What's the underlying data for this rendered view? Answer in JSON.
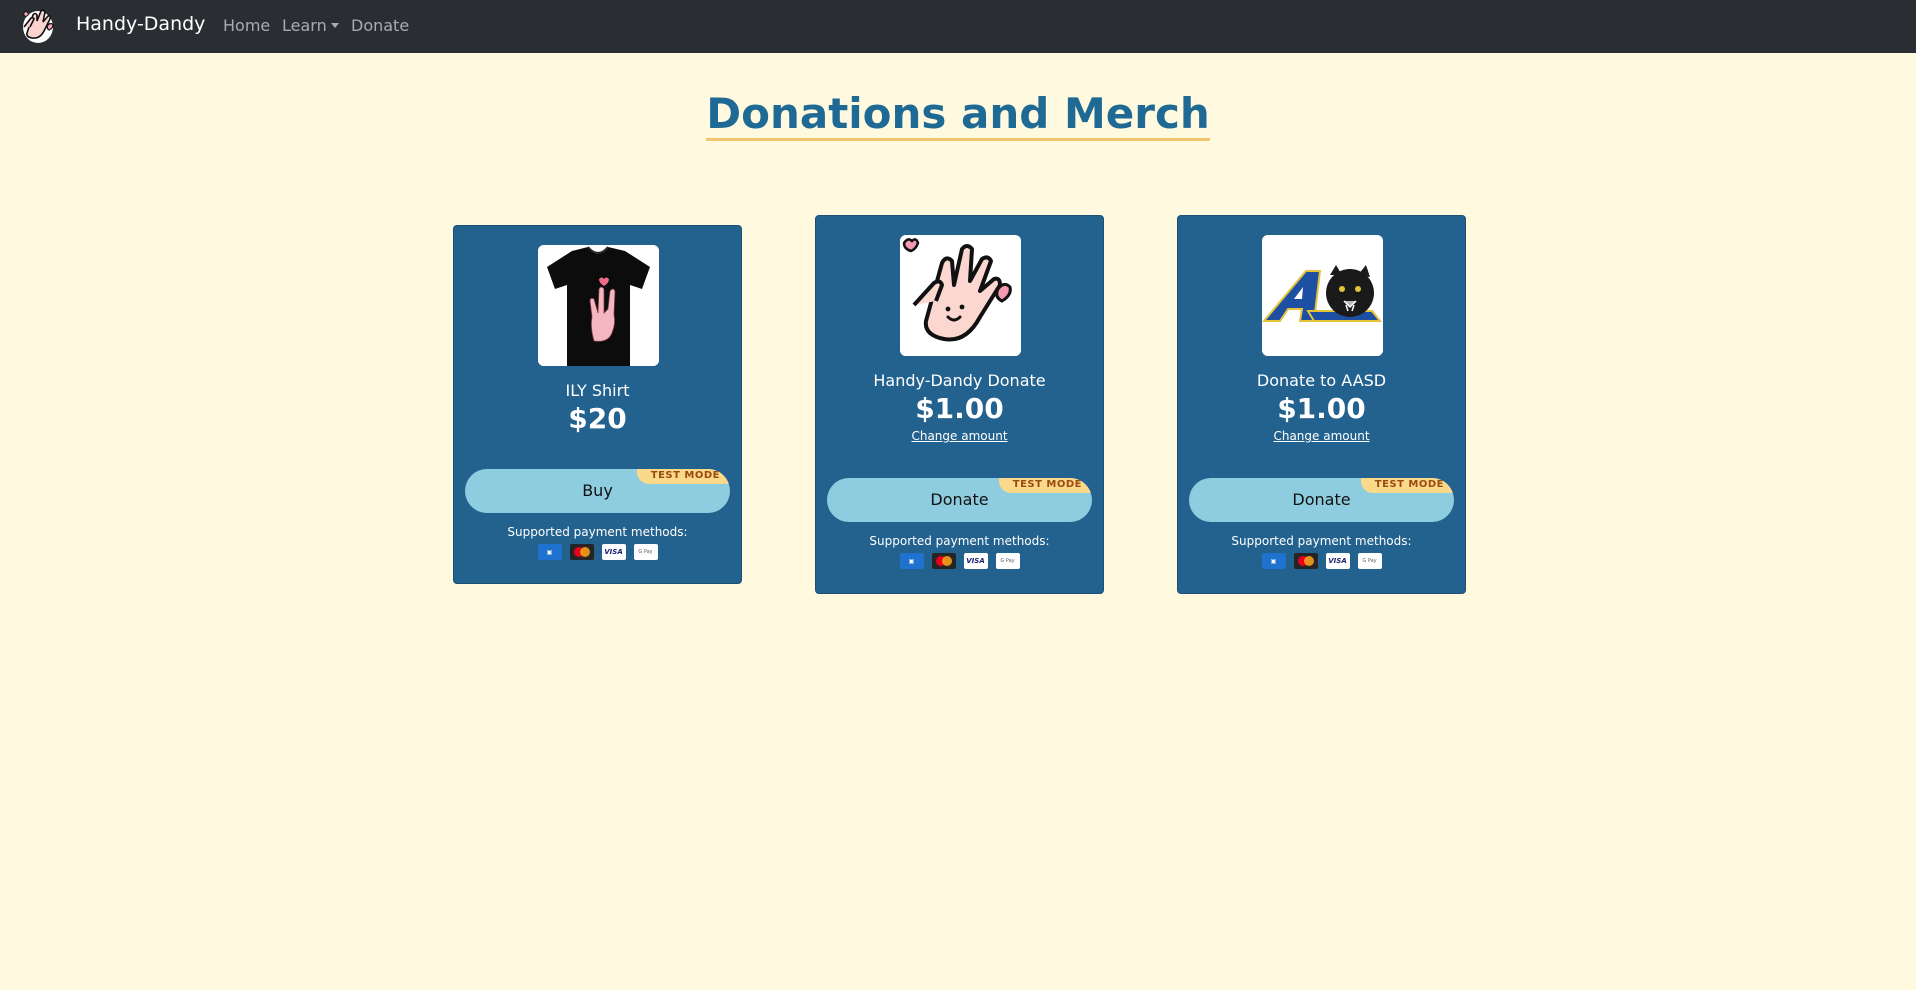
{
  "nav": {
    "brand": "Handy-Dandy",
    "links": [
      {
        "label": "Home"
      },
      {
        "label": "Learn"
      },
      {
        "label": "Donate"
      }
    ]
  },
  "page": {
    "title": "Donations and Merch"
  },
  "cards": [
    {
      "name": "ILY Shirt",
      "price": "$20",
      "button": "Buy",
      "badge": "TEST MODE",
      "supported": "Supported payment methods:",
      "image_icon": "ily-shirt-image"
    },
    {
      "name": "Handy-Dandy Donate",
      "price": "$1.00",
      "change_amount": "Change amount",
      "button": "Donate",
      "badge": "TEST MODE",
      "supported": "Supported payment methods:",
      "image_icon": "hands-heart-image"
    },
    {
      "name": "Donate to AASD",
      "price": "$1.00",
      "change_amount": "Change amount",
      "button": "Donate",
      "badge": "TEST MODE",
      "supported": "Supported payment methods:",
      "image_icon": "aasd-logo-image"
    }
  ],
  "payment_methods": [
    "amex-icon",
    "mastercard-icon",
    "visa-icon",
    "gpay-icon"
  ],
  "payment_labels": {
    "visa": "VISA",
    "gpay": "G Pay"
  },
  "colors": {
    "background": "#fffadf",
    "navbar": "#2a2e33",
    "card": "#23628e",
    "title": "#1f6a94",
    "button": "#8ecde0",
    "badge": "#fbd98b"
  }
}
